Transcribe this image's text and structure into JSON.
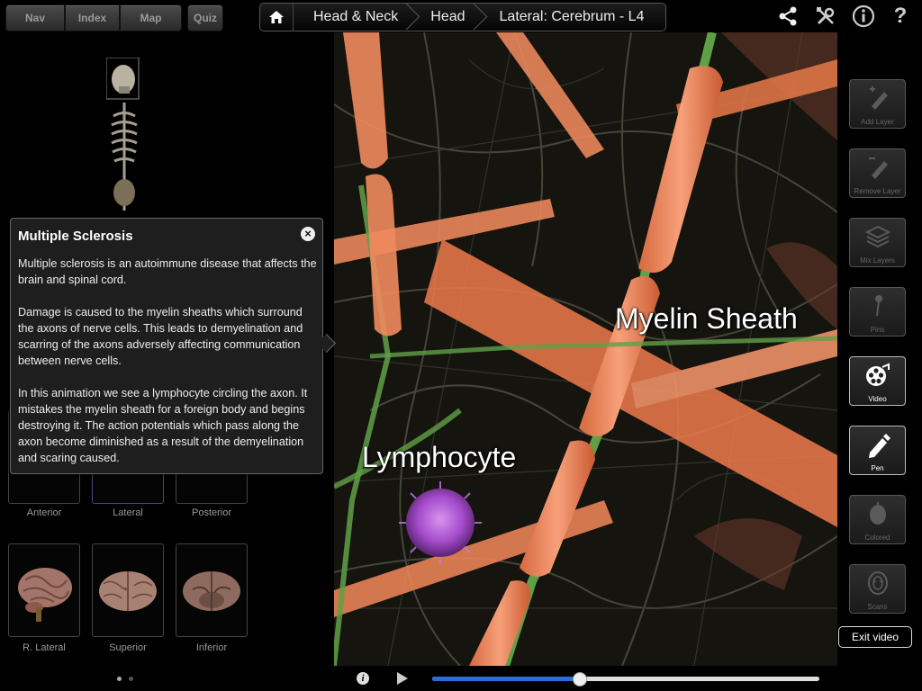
{
  "nav_tabs": {
    "nav": "Nav",
    "index": "Index",
    "map": "Map"
  },
  "quiz_label": "Quiz",
  "breadcrumb": [
    "Head & Neck",
    "Head",
    "Lateral: Cerebrum - L4"
  ],
  "top_icons": [
    "home-icon",
    "share-icon",
    "tools-icon",
    "info-icon",
    "help-icon"
  ],
  "thumbnails": [
    {
      "label": "Anterior"
    },
    {
      "label": "Lateral"
    },
    {
      "label": "Posterior"
    },
    {
      "label": "R. Lateral"
    },
    {
      "label": "Superior"
    },
    {
      "label": "Inferior"
    }
  ],
  "page_dots": {
    "count": 2,
    "active": 1
  },
  "popup": {
    "title": "Multiple Sclerosis",
    "paragraphs": [
      "Multiple sclerosis is an autoimmune disease that affects the brain and spinal cord.",
      "Damage is caused to the myelin sheaths which surround the axons of nerve cells.  This leads to demyelination and scarring of the axons adversely affecting communication between nerve cells.",
      "In this animation we see a lymphocyte circling the axon.  It mistakes the myelin sheath for a foreign body and begins destroying it.  The action potentials which pass along the axon become diminished as a result of the demyelination and scaring caused."
    ]
  },
  "scene_labels": {
    "myelin": "Myelin Sheath",
    "lymphocyte": "Lymphocyte"
  },
  "player": {
    "progress": 0.38
  },
  "tools": [
    {
      "label": "Add Layer",
      "icon": "add-layer-icon",
      "active": false
    },
    {
      "label": "Remove Layer",
      "icon": "remove-layer-icon",
      "active": false
    },
    {
      "label": "Mix Layers",
      "icon": "mix-layers-icon",
      "active": false
    },
    {
      "label": "Pins",
      "icon": "pin-icon",
      "active": false
    },
    {
      "label": "Video",
      "icon": "video-reel-icon",
      "active": true
    },
    {
      "label": "Pen",
      "icon": "pen-icon",
      "active": true
    },
    {
      "label": "Colored",
      "icon": "colored-icon",
      "active": false
    },
    {
      "label": "Scans",
      "icon": "scans-icon",
      "active": false
    }
  ],
  "exit_video_label": "Exit video",
  "colors": {
    "accent": "#2f6bd8",
    "myelin": "#f08a5d",
    "axon": "#5fa046",
    "lymphocyte": "#b44fd8"
  }
}
